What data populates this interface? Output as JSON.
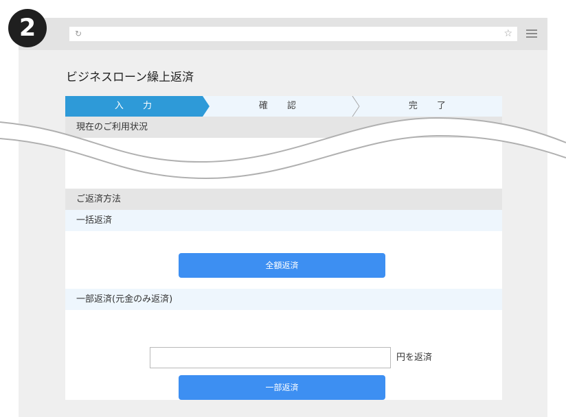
{
  "step_badge": "2",
  "browser": {
    "address_value": "",
    "reload_icon": "reload-icon",
    "star_icon": "star-icon",
    "menu_icon": "hamburger-menu-icon"
  },
  "page": {
    "title": "ビジネスローン繰上返済"
  },
  "stepper": {
    "steps": [
      {
        "label": "入 力",
        "active": true
      },
      {
        "label": "確 認",
        "active": false
      },
      {
        "label": "完 了",
        "active": false
      }
    ],
    "active_color": "#2e9ad8",
    "inactive_color": "#eef6fd"
  },
  "sections": {
    "usage_status": "現在のご利用状況",
    "repayment_method": "ご返済方法",
    "full_repayment": "一括返済",
    "partial_repayment": "一部返済(元金のみ返済)"
  },
  "buttons": {
    "full_label": "全額返済",
    "partial_label": "一部返済"
  },
  "amount_field": {
    "value": "",
    "suffix": "円を返済"
  },
  "colors": {
    "button": "#3d8ff2",
    "badge": "#1f1f1f",
    "section_bg": "#e5e5e5",
    "subsection_bg": "#eef6fd"
  }
}
